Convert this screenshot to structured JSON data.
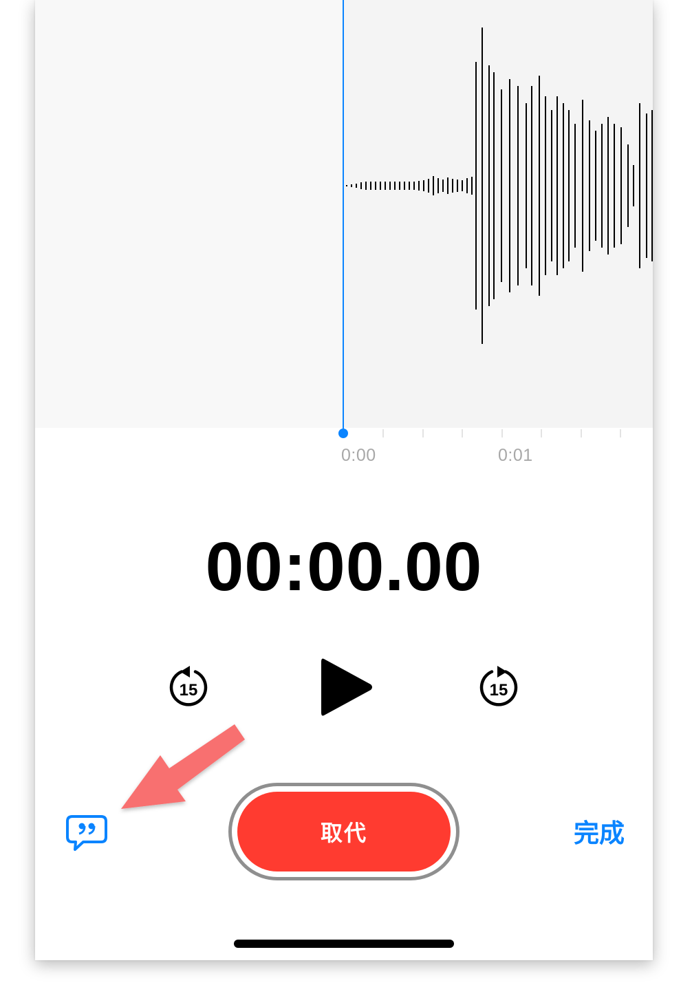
{
  "timeline": {
    "tick_labels": [
      "0:00",
      "0:01"
    ]
  },
  "timer": {
    "elapsed": "00:00.00"
  },
  "controls": {
    "skip_back_seconds": "15",
    "skip_forward_seconds": "15"
  },
  "bottom_bar": {
    "replace_label": "取代",
    "done_label": "完成"
  },
  "colors": {
    "accent": "#0a84ff",
    "record_red": "#ff3b30",
    "annotation_arrow": "#f87070"
  },
  "icons": {
    "transcript": "speech-bubble-quote-icon",
    "skip_back": "rewind-15-icon",
    "play": "play-icon",
    "skip_forward": "forward-15-icon"
  }
}
